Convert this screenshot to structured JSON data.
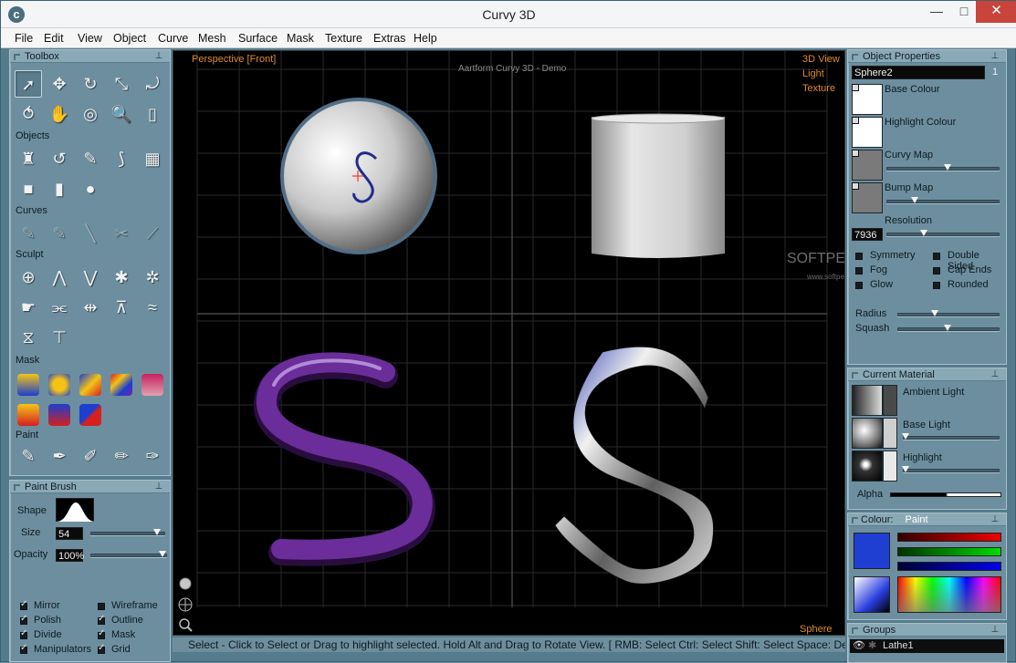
{
  "window": {
    "title": "Curvy 3D",
    "minimize": "—",
    "maximize": "□",
    "close": "✕"
  },
  "menu": [
    "File",
    "Edit",
    "View",
    "Object",
    "Curve",
    "Mesh",
    "Surface",
    "Mask",
    "Texture",
    "Extras",
    "Help"
  ],
  "toolbox": {
    "title": "Toolbox",
    "sections": {
      "objects": "Objects",
      "curves": "Curves",
      "sculpt": "Sculpt",
      "mask": "Mask",
      "paint": "Paint"
    },
    "icons_top": [
      "select-tool-icon",
      "move-tool-icon",
      "rotate-tool-icon",
      "scale-tool-icon",
      "transform-tool-icon",
      "link-tool-icon",
      "hand-pan-icon",
      "target-icon",
      "zoom-icon",
      "page-icon"
    ],
    "icons_objects": [
      "lathe-icon",
      "extrude-icon",
      "tube-icon",
      "blob-icon",
      "flat-icon",
      "cube-icon",
      "cylinder-icon",
      "sphere-icon"
    ],
    "icons_curves": [
      "add-point-icon",
      "edit-point-icon",
      "knife-icon",
      "delete-point-icon",
      "merge-icon"
    ],
    "icons_sculpt": [
      "sculpt-target-icon",
      "pinch-up-icon",
      "pinch-down-icon",
      "expand-icon",
      "contract-icon",
      "smudge-icon",
      "mirror-sculpt-icon",
      "flatten-icon",
      "lift-icon",
      "wave-icon",
      "mirror-split-icon",
      "level-icon"
    ],
    "icons_mask": [
      "mask-blue-icon",
      "mask-pie-icon",
      "mask-gradient-icon",
      "mask-rainbow-icon",
      "mask-pink-icon",
      "mask-redgold-icon",
      "mask-blue-gradient-icon",
      "mask-diagonal-icon"
    ],
    "icons_paint": [
      "paint-brush-icon",
      "airbrush-icon",
      "eyedropper-icon",
      "smudge-brush-icon",
      "stamp-brush-icon"
    ]
  },
  "paint_brush": {
    "title": "Paint Brush",
    "shape_label": "Shape",
    "size_label": "Size",
    "size": "54",
    "size_level": 0.95,
    "opacity_label": "Opacity",
    "opacity": "100%",
    "opacity_level": 1.0
  },
  "view_options": {
    "mirror": "Mirror",
    "wireframe": "Wireframe",
    "polish": "Polish",
    "outline": "Outline",
    "divide": "Divide",
    "mask": "Mask",
    "manipulators": "Manipulators",
    "grid": "Grid"
  },
  "viewport": {
    "view_label": "Perspective [Front]",
    "watermark": "Aartform Curvy 3D - Demo",
    "tabs": [
      "3D View",
      "Light",
      "Texture"
    ],
    "selected_name": "Sphere",
    "softpedia": "SOFTPEDIA®",
    "softpedia_url": "www.softpedia.com"
  },
  "status": "Select - Click to Select or Drag to highlight selected. Hold Alt and Drag to Rotate View. [ RMB: Select   Ctrl: Select   Shift: Select   Space: Deselect",
  "object_properties": {
    "title": "Object Properties",
    "name": "Sphere2",
    "count": "1",
    "base_colour": "Base Colour",
    "highlight_colour": "Highlight Colour",
    "curvy_map": "Curvy Map",
    "bump_map": "Bump Map",
    "resolution_label": "Resolution",
    "resolution": "7936",
    "symmetry": "Symmetry",
    "fog": "Fog",
    "glow": "Glow",
    "double_sided": "Double Sided",
    "cap_ends": "Cap Ends",
    "rounded": "Rounded",
    "radius": "Radius",
    "squash": "Squash"
  },
  "current_material": {
    "title": "Current Material",
    "ambient": "Ambient Light",
    "base": "Base Light",
    "highlight": "Highlight",
    "alpha": "Alpha"
  },
  "colour": {
    "label": "Colour:",
    "mode": "Paint",
    "swatch": "#1f3fd2"
  },
  "groups": {
    "title": "Groups",
    "item": "Lathe1"
  }
}
